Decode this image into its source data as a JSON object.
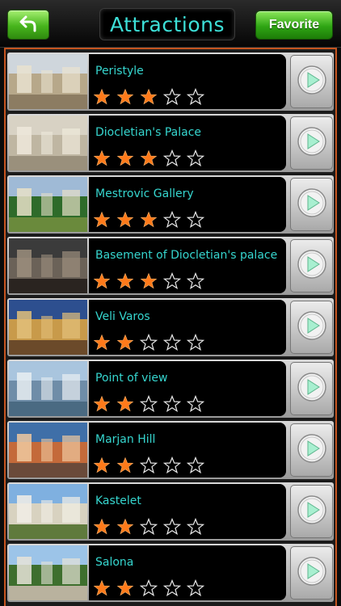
{
  "header": {
    "back_icon": "back-arrow-icon",
    "title": "Attractions",
    "favorite_label": "Favorite",
    "accent": "#3de0d8",
    "button_color": "#2fa514"
  },
  "list": {
    "border_color": "#c4541f",
    "star_color": "#ff7a1a",
    "items": [
      {
        "name": "Peristyle",
        "rating": 3,
        "max_rating": 5
      },
      {
        "name": "Diocletian's Palace",
        "rating": 3,
        "max_rating": 5
      },
      {
        "name": "Mestrovic Gallery",
        "rating": 3,
        "max_rating": 5
      },
      {
        "name": "Basement of Diocletian's palace",
        "rating": 3,
        "max_rating": 5
      },
      {
        "name": "Veli Varos",
        "rating": 2,
        "max_rating": 5
      },
      {
        "name": "Point of view",
        "rating": 2,
        "max_rating": 5
      },
      {
        "name": "Marjan Hill",
        "rating": 2,
        "max_rating": 5
      },
      {
        "name": "Kastelet",
        "rating": 2,
        "max_rating": 5
      },
      {
        "name": "Salona",
        "rating": 2,
        "max_rating": 5
      }
    ]
  }
}
